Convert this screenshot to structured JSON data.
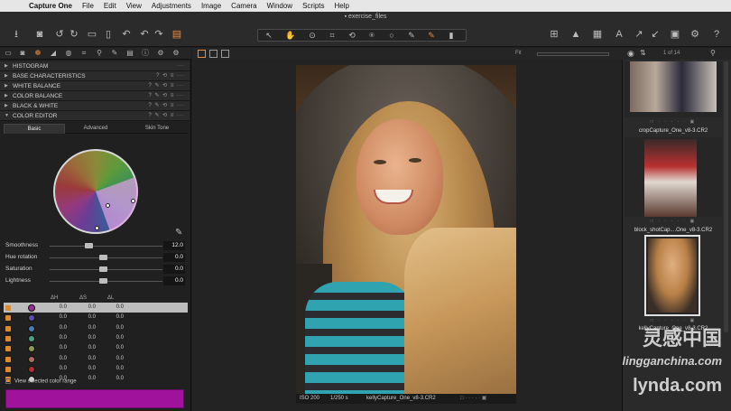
{
  "menubar": {
    "app_name": "Capture One",
    "items": [
      "File",
      "Edit",
      "View",
      "Adjustments",
      "Image",
      "Camera",
      "Window",
      "Scripts",
      "Help"
    ]
  },
  "window": {
    "title": "exercise_files"
  },
  "left_panel": {
    "tools": [
      {
        "label": "HISTOGRAM"
      },
      {
        "label": "BASE CHARACTERISTICS"
      },
      {
        "label": "WHITE BALANCE"
      },
      {
        "label": "COLOR BALANCE"
      },
      {
        "label": "BLACK & WHITE"
      },
      {
        "label": "COLOR EDITOR"
      }
    ],
    "color_editor": {
      "tabs": [
        "Basic",
        "Advanced",
        "Skin Tone"
      ],
      "active_tab": "Basic",
      "sliders": [
        {
          "label": "Smoothness",
          "value": "12.0",
          "level": 0.37
        },
        {
          "label": "Hue rotation",
          "value": "0.0",
          "level": 0.5
        },
        {
          "label": "Saturation",
          "value": "0.0",
          "level": 0.5
        },
        {
          "label": "Lightness",
          "value": "0.0",
          "level": 0.5
        }
      ],
      "columns": [
        "ΔH",
        "ΔS",
        "ΔL"
      ],
      "ranges": [
        {
          "color": "#9a2d96",
          "dh": "0.0",
          "ds": "0.0",
          "dl": "0.0",
          "selected": true
        },
        {
          "color": "#5a50b0",
          "dh": "0.0",
          "ds": "0.0",
          "dl": "0.0"
        },
        {
          "color": "#4a7ab0",
          "dh": "0.0",
          "ds": "0.0",
          "dl": "0.0"
        },
        {
          "color": "#4aa080",
          "dh": "0.0",
          "ds": "0.0",
          "dl": "0.0"
        },
        {
          "color": "#8a9a50",
          "dh": "0.0",
          "ds": "0.0",
          "dl": "0.0"
        },
        {
          "color": "#b06a60",
          "dh": "0.0",
          "ds": "0.0",
          "dl": "0.0"
        },
        {
          "color": "#b03030",
          "dh": "0.0",
          "ds": "0.0",
          "dl": "0.0"
        },
        {
          "color": "#d0d0d0",
          "dh": "0.0",
          "ds": "0.0",
          "dl": "0.0"
        }
      ],
      "view_selected_label": "View selected color range",
      "selected_color": "#a0129c"
    }
  },
  "viewer": {
    "fit_label": "Fit",
    "photo_info": {
      "iso": "ISO 200",
      "shutter": "1/250 s",
      "filename": "kellyCapture_One_v8-3.CR2"
    }
  },
  "browser": {
    "count": "1 of 14",
    "thumbs": [
      {
        "label": "cropCapture_One_v8-3.CR2"
      },
      {
        "label": "block_shotCap....One_v8-3.CR2"
      },
      {
        "label": "kellyCapture_One_v8-3.CR2"
      }
    ]
  },
  "watermark": {
    "cn": "灵感中国",
    "site": "lingganchina.com",
    "brand": "lynda.com"
  }
}
